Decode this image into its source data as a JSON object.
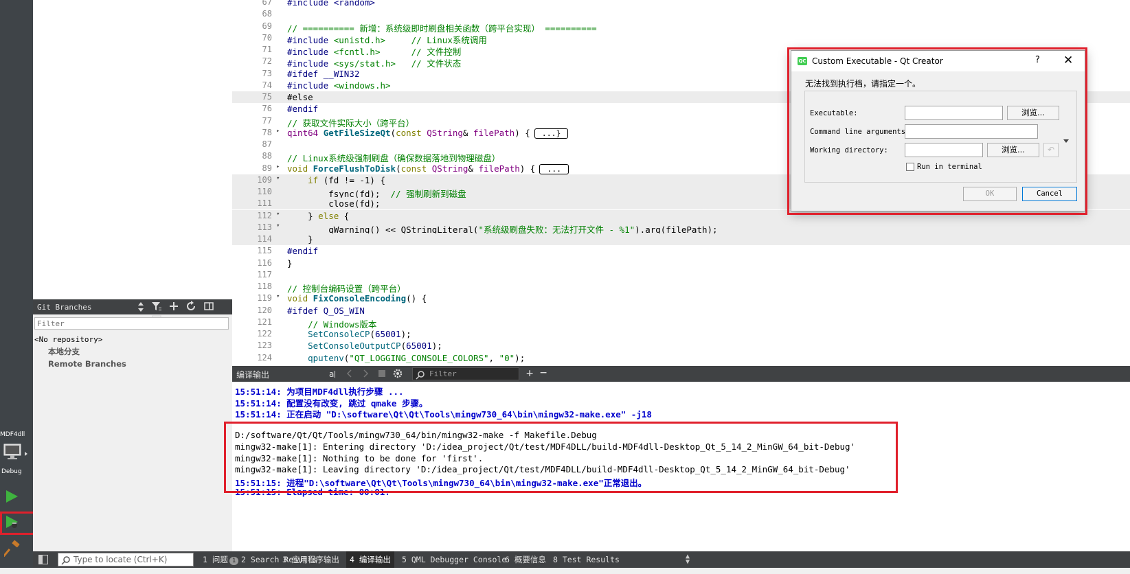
{
  "modebar": {
    "project": "MDF4dll",
    "build_type": "Debug"
  },
  "git_branches": {
    "title": "Git Branches",
    "filter_placeholder": "Filter",
    "tree": {
      "root": "<No repository>",
      "children": [
        "本地分支",
        "Remote Branches"
      ]
    }
  },
  "editor": {
    "lines": [
      {
        "n": "67",
        "fold": "",
        "html": "<span class='pp'>#include &lt;random&gt;</span>"
      },
      {
        "n": "68",
        "fold": "",
        "html": ""
      },
      {
        "n": "69",
        "fold": "",
        "html": "<span class='cm'>// ========== 新增：系统级即时刷盘相关函数（跨平台实现） ==========</span>"
      },
      {
        "n": "70",
        "fold": "",
        "html": "<span class='pp'>#include</span> <span class='str'>&lt;unistd.h&gt;</span>     <span class='cm'>// Linux系统调用</span>"
      },
      {
        "n": "71",
        "fold": "",
        "html": "<span class='pp'>#include</span> <span class='str'>&lt;fcntl.h&gt;</span>      <span class='cm'>// 文件控制</span>"
      },
      {
        "n": "72",
        "fold": "",
        "html": "<span class='pp'>#include</span> <span class='str'>&lt;sys/stat.h&gt;</span>   <span class='cm'>// 文件状态</span>"
      },
      {
        "n": "73",
        "fold": "",
        "html": "<span class='pp'>#ifdef __WIN32</span>"
      },
      {
        "n": "74",
        "fold": "",
        "html": "<span class='pp'>#include</span> <span class='str'>&lt;windows.h&gt;</span>"
      },
      {
        "n": "75",
        "fold": "",
        "html": "#else",
        "hl": true
      },
      {
        "n": "76",
        "fold": "",
        "html": "<span class='pp'>#endif</span>"
      },
      {
        "n": "77",
        "fold": "",
        "html": "<span class='cm'>// 获取文件实际大小（跨平台）</span>"
      },
      {
        "n": "78",
        "fold": "▸",
        "html": "<span class='type'>qint64</span> <span class='fn'>GetFileSizeQt</span>(<span class='kw'>const</span> <span class='type'>QString</span>&amp; <span class='ty2'>filePath</span>) {<span class='ellipsis'>...}</span>"
      },
      {
        "n": "87",
        "fold": "",
        "html": ""
      },
      {
        "n": "88",
        "fold": "",
        "html": "<span class='cm'>// Linux系统级强制刷盘（确保数据落地到物理磁盘）</span>"
      },
      {
        "n": "89",
        "fold": "▸",
        "html": "<span class='kw'>void</span> <span class='fn'>ForceFlushToDisk</span>(<span class='kw'>const</span> <span class='type'>QString</span>&amp; <span class='ty2'>filePath</span>) {<span class='ellipsis'>...</span>"
      },
      {
        "n": "109",
        "fold": "▾",
        "html": "    <span class='kw'>if</span> (fd != -1) {",
        "hl": true
      },
      {
        "n": "110",
        "fold": "",
        "html": "        fsync(fd);  <span class='cm'>// 强制刷新到磁盘</span>",
        "hl": true
      },
      {
        "n": "111",
        "fold": "",
        "html": "        close(fd);",
        "hl": true
      },
      {
        "n": "112",
        "fold": "▾",
        "html": "    } <span class='kw'>else</span> {",
        "hl": true
      },
      {
        "n": "113",
        "fold": "▾",
        "html": "        qWarning() &lt;&lt; QStringLiteral(<span class='str'>\"系统级刷盘失败：无法打开文件 - %1\"</span>).arg(filePath);",
        "hl": true
      },
      {
        "n": "114",
        "fold": "",
        "html": "    }",
        "hl": true
      },
      {
        "n": "115",
        "fold": "",
        "html": "<span class='pp'>#endif</span>"
      },
      {
        "n": "116",
        "fold": "",
        "html": "}"
      },
      {
        "n": "117",
        "fold": "",
        "html": ""
      },
      {
        "n": "118",
        "fold": "",
        "html": "<span class='cm'>// 控制台编码设置（跨平台）</span>"
      },
      {
        "n": "119",
        "fold": "▾",
        "html": "<span class='kw'>void</span> <span class='fn'>FixConsoleEncoding</span>() {"
      },
      {
        "n": "120",
        "fold": "",
        "html": "<span class='pp'>#ifdef Q_OS_WIN</span>"
      },
      {
        "n": "121",
        "fold": "",
        "html": "    <span class='cm'>// Windows版本</span>"
      },
      {
        "n": "122",
        "fold": "",
        "html": "    <span class='fn' style='font-weight:normal;color:#00677c'>SetConsoleCP</span>(<span class='num'>65001</span>);"
      },
      {
        "n": "123",
        "fold": "",
        "html": "    <span class='fn' style='font-weight:normal;color:#00677c'>SetConsoleOutputCP</span>(<span class='num'>65001</span>);"
      },
      {
        "n": "124",
        "fold": "",
        "html": "    <span class='fn' style='font-weight:normal;color:#00677c'>qputenv</span>(<span class='str'>\"QT_LOGGING_CONSOLE_COLORS\"</span>, <span class='str'>\"0\"</span>);"
      }
    ]
  },
  "output_pane": {
    "title": "编译输出",
    "filter_placeholder": "Filter",
    "lines": [
      {
        "text": "15:51:14: 为项目MDF4dll执行步骤 ...",
        "style": "blue"
      },
      {
        "text": "15:51:14: 配置没有改变, 跳过 qmake 步骤。",
        "style": "blue"
      },
      {
        "text": "15:51:14: 正在启动 \"D:\\software\\Qt\\Qt\\Tools\\mingw730_64\\bin\\mingw32-make.exe\" -j18",
        "style": "blue"
      },
      {
        "text": "",
        "style": "plain"
      },
      {
        "text": "D:/software/Qt/Qt/Tools/mingw730_64/bin/mingw32-make -f Makefile.Debug",
        "style": "plain"
      },
      {
        "text": "mingw32-make[1]: Entering directory 'D:/idea_project/Qt/test/MDF4DLL/build-MDF4dll-Desktop_Qt_5_14_2_MinGW_64_bit-Debug'",
        "style": "plain"
      },
      {
        "text": "mingw32-make[1]: Nothing to be done for 'first'.",
        "style": "plain"
      },
      {
        "text": "mingw32-make[1]: Leaving directory 'D:/idea_project/Qt/test/MDF4DLL/build-MDF4dll-Desktop_Qt_5_14_2_MinGW_64_bit-Debug'",
        "style": "plain"
      },
      {
        "text": "15:51:15: 进程\"D:\\software\\Qt\\Qt\\Tools\\mingw730_64\\bin\\mingw32-make.exe\"正常退出。",
        "style": "blue"
      },
      {
        "text": "15:51:15: Elapsed time: 00:01.",
        "style": "blue"
      }
    ]
  },
  "statusbar": {
    "locator_placeholder": "Type to locate (Ctrl+K)",
    "tabs": [
      {
        "label": "1 问题",
        "badge": "1"
      },
      {
        "label": "2 Search Results",
        "badge": ""
      },
      {
        "label": "3 应用程序输出",
        "badge": ""
      },
      {
        "label": "4 编译输出",
        "badge": "",
        "active": true
      },
      {
        "label": "5 QML Debugger Console",
        "badge": ""
      },
      {
        "label": "6 概要信息",
        "badge": ""
      },
      {
        "label": "8 Test Results",
        "badge": ""
      }
    ]
  },
  "dialog": {
    "icon_text": "QC",
    "title": "Custom Executable - Qt Creator",
    "help": "?",
    "close": "✕",
    "message": "无法找到执行档，请指定一个。",
    "executable_label": "Executable:",
    "args_label": "Command line arguments:",
    "workdir_label": "Working directory:",
    "browse_label": "浏览...",
    "run_in_terminal_label": "Run in terminal",
    "ok_label": "OK",
    "cancel_label": "Cancel"
  },
  "colors": {
    "highlight_red": "#e0202c",
    "run_green": "#3fb33f",
    "output_blue": "#0000cc"
  }
}
